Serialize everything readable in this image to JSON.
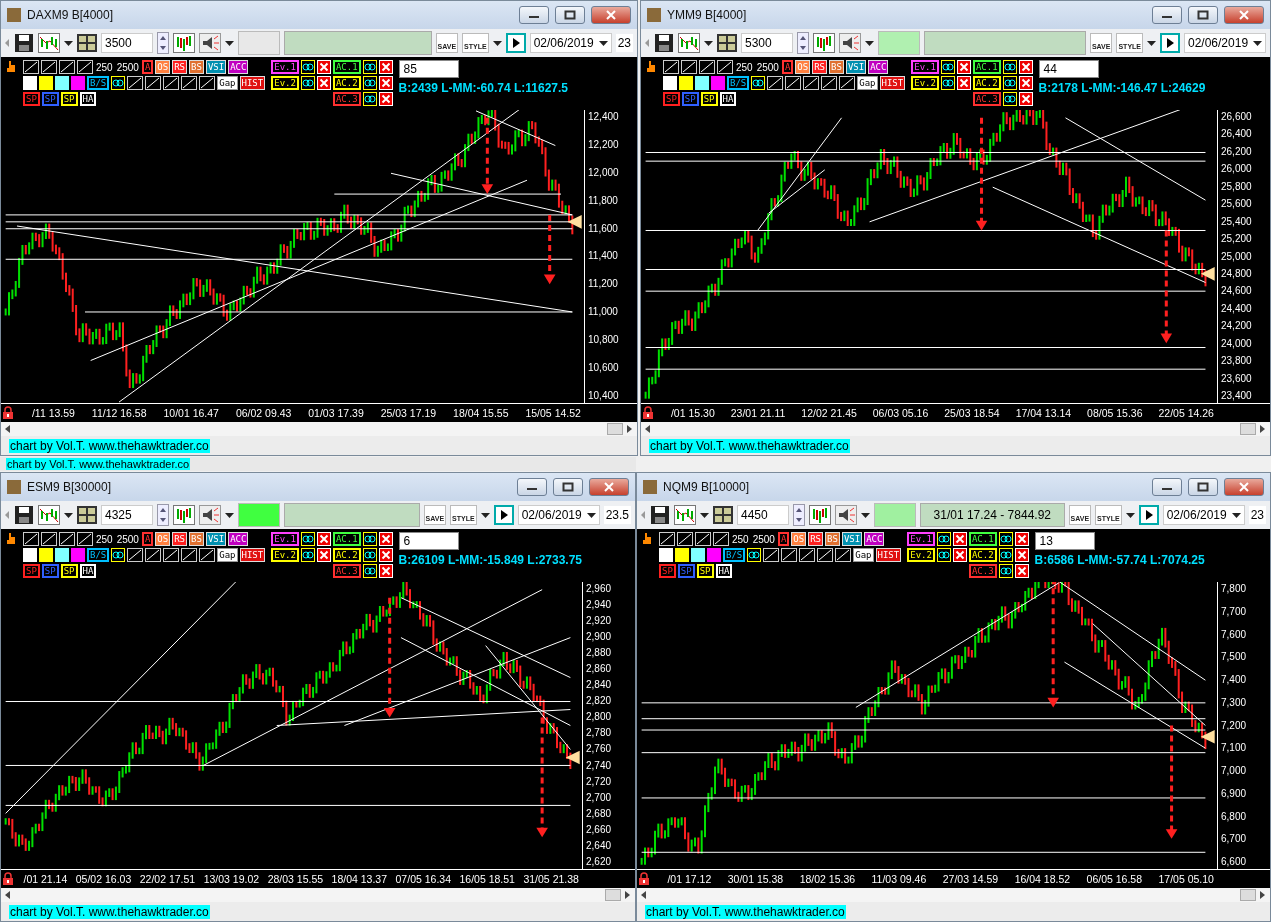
{
  "windows": [
    {
      "title": "DAXM9 B[4000]",
      "bars": "3500",
      "color": "#e8e8e8",
      "buttons": [
        "SAVE",
        "STYLE"
      ],
      "date": "02/06/2019",
      "time_cut": "23",
      "level_box": "85",
      "info": "B:2439 L-MM:-60.74 L:11627.5",
      "tool_rows": [
        [
          {
            "kind": "tool"
          },
          {
            "kind": "tool"
          },
          {
            "kind": "tool"
          },
          {
            "kind": "tool"
          },
          {
            "kind": "num",
            "label": "250"
          },
          {
            "kind": "num",
            "label": "2500"
          },
          {
            "kind": "outline",
            "label": "A",
            "color": "#ff3030"
          },
          {
            "kind": "filled",
            "label": "OS",
            "color": "#ff8040"
          },
          {
            "kind": "filled",
            "label": "RS",
            "color": "#ff2020"
          },
          {
            "kind": "filled",
            "label": "BS",
            "color": "#e07030"
          },
          {
            "kind": "filled",
            "label": "VSI",
            "color": "#0090b0"
          },
          {
            "kind": "filled",
            "label": "ACC",
            "color": "#c000c0"
          }
        ],
        [
          {
            "kind": "swatch",
            "color": "#ffffff"
          },
          {
            "kind": "swatch",
            "color": "#ffff00"
          },
          {
            "kind": "swatch",
            "color": "#80ffff"
          },
          {
            "kind": "swatch",
            "color": "#ff00ff"
          },
          {
            "kind": "outline",
            "label": "B/S",
            "color": "#00c0ff"
          },
          {
            "kind": "link"
          },
          {
            "kind": "tool"
          },
          {
            "kind": "tool"
          },
          {
            "kind": "tool"
          },
          {
            "kind": "tool"
          },
          {
            "kind": "tool"
          },
          {
            "kind": "plain",
            "label": "Gap",
            "color": "#ffffff"
          },
          {
            "kind": "filled",
            "label": "HIST",
            "color": "#e01010"
          }
        ],
        [
          {
            "kind": "outline",
            "label": "SP",
            "color": "#ff2020"
          },
          {
            "kind": "outline",
            "label": "SP",
            "color": "#3060ff"
          },
          {
            "kind": "outline",
            "label": "SP",
            "color": "#ffff00"
          },
          {
            "kind": "outline",
            "label": "HA",
            "color": "#ffffff"
          }
        ]
      ],
      "event_rows": [
        [
          {
            "kind": "outline",
            "label": "Ev.1",
            "color": "#ff40ff"
          },
          {
            "kind": "link"
          },
          {
            "kind": "close"
          },
          {
            "kind": "outline",
            "label": "AC.1",
            "color": "#40ff40"
          },
          {
            "kind": "link"
          },
          {
            "kind": "close"
          }
        ],
        [
          {
            "kind": "outline",
            "label": "Ev.2",
            "color": "#ffff00"
          },
          {
            "kind": "link"
          },
          {
            "kind": "close"
          },
          {
            "kind": "outline",
            "label": "AC.2",
            "color": "#ffff00"
          },
          {
            "kind": "link"
          },
          {
            "kind": "close"
          }
        ],
        [
          {
            "kind": "outline",
            "label": "AC.3",
            "color": "#ff3030"
          },
          {
            "kind": "link"
          },
          {
            "kind": "close"
          }
        ]
      ],
      "price_axis": [
        "12,400",
        "12,200",
        "12,000",
        "11,800",
        "11,600",
        "11,400",
        "11,200",
        "11,000",
        "10,800",
        "10,600",
        "10,400"
      ],
      "time_axis": [
        "/11 13.59",
        "11/12 16.58",
        "10/01 16.47",
        "06/02 09.43",
        "01/03 17.39",
        "25/03 17.19",
        "18/04 15.55",
        "15/05 14.52"
      ],
      "footer": "chart by Vol.T. www.thehawktrader.co"
    },
    {
      "title": "YMM9 B[4000]",
      "bars": "5300",
      "color": "#b0f0b0",
      "buttons": [
        "SAVE",
        "STYLE"
      ],
      "date": "02/06/2019",
      "level_box": "44",
      "info": "B:2178 L-MM:-146.47 L:24629",
      "tool_rows": [
        [
          {
            "kind": "tool"
          },
          {
            "kind": "tool"
          },
          {
            "kind": "tool"
          },
          {
            "kind": "tool"
          },
          {
            "kind": "num",
            "label": "250"
          },
          {
            "kind": "num",
            "label": "2500"
          },
          {
            "kind": "outline",
            "label": "A",
            "color": "#ff3030"
          },
          {
            "kind": "filled",
            "label": "OS",
            "color": "#ff8040"
          },
          {
            "kind": "filled",
            "label": "RS",
            "color": "#ff2020"
          },
          {
            "kind": "filled",
            "label": "BS",
            "color": "#e07030"
          },
          {
            "kind": "filled",
            "label": "VSI",
            "color": "#0090b0"
          },
          {
            "kind": "filled",
            "label": "ACC",
            "color": "#c000c0"
          }
        ],
        [
          {
            "kind": "swatch",
            "color": "#ffffff"
          },
          {
            "kind": "swatch",
            "color": "#ffff00"
          },
          {
            "kind": "swatch",
            "color": "#80ffff"
          },
          {
            "kind": "swatch",
            "color": "#ff00ff"
          },
          {
            "kind": "outline",
            "label": "B/S",
            "color": "#00c0ff"
          },
          {
            "kind": "link"
          },
          {
            "kind": "tool"
          },
          {
            "kind": "tool"
          },
          {
            "kind": "tool"
          },
          {
            "kind": "tool"
          },
          {
            "kind": "tool"
          },
          {
            "kind": "plain",
            "label": "Gap",
            "color": "#ffffff"
          },
          {
            "kind": "filled",
            "label": "HIST",
            "color": "#e01010"
          }
        ],
        [
          {
            "kind": "outline",
            "label": "SP",
            "color": "#ff2020"
          },
          {
            "kind": "outline",
            "label": "SP",
            "color": "#3060ff"
          },
          {
            "kind": "outline",
            "label": "SP",
            "color": "#ffff00"
          },
          {
            "kind": "outline",
            "label": "HA",
            "color": "#ffffff"
          }
        ]
      ],
      "event_rows": [
        [
          {
            "kind": "outline",
            "label": "Ev.1",
            "color": "#ff40ff"
          },
          {
            "kind": "link"
          },
          {
            "kind": "close"
          },
          {
            "kind": "outline",
            "label": "AC.1",
            "color": "#40ff40"
          },
          {
            "kind": "link"
          },
          {
            "kind": "close"
          }
        ],
        [
          {
            "kind": "outline",
            "label": "Ev.2",
            "color": "#ffff00"
          },
          {
            "kind": "link"
          },
          {
            "kind": "close"
          },
          {
            "kind": "outline",
            "label": "AC.2",
            "color": "#ffff00"
          },
          {
            "kind": "link"
          },
          {
            "kind": "close"
          }
        ],
        [
          {
            "kind": "outline",
            "label": "AC.3",
            "color": "#ff3030"
          },
          {
            "kind": "link"
          },
          {
            "kind": "close"
          }
        ]
      ],
      "price_axis": [
        "26,600",
        "26,400",
        "26,200",
        "26,000",
        "25,800",
        "25,600",
        "25,400",
        "25,200",
        "25,000",
        "24,800",
        "24,600",
        "24,400",
        "24,200",
        "24,000",
        "23,800",
        "23,600",
        "23,400"
      ],
      "time_axis": [
        "/01 15.30",
        "23/01 21.11",
        "12/02 21.45",
        "06/03 05.16",
        "25/03 18.54",
        "17/04 13.14",
        "08/05 15.36",
        "22/05 14.26"
      ],
      "footer": "chart by Vol.T. www.thehawktrader.co"
    },
    {
      "title": "ESM9 B[30000]",
      "bars": "4325",
      "color": "#40ff40",
      "buttons": [
        "SAVE",
        "STYLE"
      ],
      "date": "02/06/2019",
      "time_cut": "23.5",
      "level_box": "6",
      "info": "B:26109 L-MM:-15.849 L:2733.75",
      "tool_rows": [
        [
          {
            "kind": "tool"
          },
          {
            "kind": "tool"
          },
          {
            "kind": "tool"
          },
          {
            "kind": "tool"
          },
          {
            "kind": "num",
            "label": "250"
          },
          {
            "kind": "num",
            "label": "2500"
          },
          {
            "kind": "outline",
            "label": "A",
            "color": "#ff3030"
          },
          {
            "kind": "filled",
            "label": "OS",
            "color": "#ff8040"
          },
          {
            "kind": "filled",
            "label": "RS",
            "color": "#ff2020"
          },
          {
            "kind": "filled",
            "label": "BS",
            "color": "#e07030"
          },
          {
            "kind": "filled",
            "label": "VSI",
            "color": "#0090b0"
          },
          {
            "kind": "filled",
            "label": "ACC",
            "color": "#c000c0"
          }
        ],
        [
          {
            "kind": "swatch",
            "color": "#ffffff"
          },
          {
            "kind": "swatch",
            "color": "#ffff00"
          },
          {
            "kind": "swatch",
            "color": "#80ffff"
          },
          {
            "kind": "swatch",
            "color": "#ff00ff"
          },
          {
            "kind": "outline",
            "label": "B/S",
            "color": "#00c0ff"
          },
          {
            "kind": "link"
          },
          {
            "kind": "tool"
          },
          {
            "kind": "tool"
          },
          {
            "kind": "tool"
          },
          {
            "kind": "tool"
          },
          {
            "kind": "tool"
          },
          {
            "kind": "plain",
            "label": "Gap",
            "color": "#ffffff"
          },
          {
            "kind": "filled",
            "label": "HIST",
            "color": "#e01010"
          }
        ],
        [
          {
            "kind": "outline",
            "label": "SP",
            "color": "#ff2020"
          },
          {
            "kind": "outline",
            "label": "SP",
            "color": "#3060ff"
          },
          {
            "kind": "outline",
            "label": "SP",
            "color": "#ffff00"
          },
          {
            "kind": "outline",
            "label": "HA",
            "color": "#ffffff"
          }
        ]
      ],
      "event_rows": [
        [
          {
            "kind": "outline",
            "label": "Ev.1",
            "color": "#ff40ff"
          },
          {
            "kind": "link"
          },
          {
            "kind": "close"
          },
          {
            "kind": "outline",
            "label": "AC.1",
            "color": "#40ff40"
          },
          {
            "kind": "link"
          },
          {
            "kind": "close"
          }
        ],
        [
          {
            "kind": "outline",
            "label": "Ev.2",
            "color": "#ffff00"
          },
          {
            "kind": "link"
          },
          {
            "kind": "close"
          },
          {
            "kind": "outline",
            "label": "AC.2",
            "color": "#ffff00"
          },
          {
            "kind": "link"
          },
          {
            "kind": "close"
          }
        ],
        [
          {
            "kind": "outline",
            "label": "AC.3",
            "color": "#ff3030"
          },
          {
            "kind": "link"
          },
          {
            "kind": "close"
          }
        ]
      ],
      "price_axis": [
        "2,960",
        "2,940",
        "2,920",
        "2,900",
        "2,880",
        "2,860",
        "2,840",
        "2,820",
        "2,800",
        "2,780",
        "2,760",
        "2,740",
        "2,720",
        "2,700",
        "2,680",
        "2,660",
        "2,640",
        "2,620"
      ],
      "time_axis": [
        "/01 21.14",
        "05/02 16.03",
        "22/02 17.51",
        "13/03 19.02",
        "28/03 15.55",
        "18/04 13.37",
        "07/05 16.34",
        "16/05 18.51",
        "31/05 21.38"
      ],
      "footer": "chart by Vol.T. www.thehawktrader.co"
    },
    {
      "title": "NQM9 B[10000]",
      "bars": "4450",
      "color": "#a0f0a0",
      "status_text": "31/01 17.24 - 7844.92",
      "buttons": [
        "SAVE",
        "STYLE"
      ],
      "date": "02/06/2019",
      "time_cut": "23",
      "level_box": "13",
      "info": "B:6586 L-MM:-57.74 L:7074.25",
      "tool_rows": [
        [
          {
            "kind": "tool"
          },
          {
            "kind": "tool"
          },
          {
            "kind": "tool"
          },
          {
            "kind": "tool"
          },
          {
            "kind": "num",
            "label": "250"
          },
          {
            "kind": "num",
            "label": "2500"
          },
          {
            "kind": "outline",
            "label": "A",
            "color": "#ff3030"
          },
          {
            "kind": "filled",
            "label": "OS",
            "color": "#ff8040"
          },
          {
            "kind": "filled",
            "label": "RS",
            "color": "#ff2020"
          },
          {
            "kind": "filled",
            "label": "BS",
            "color": "#e07030"
          },
          {
            "kind": "filled",
            "label": "VSI",
            "color": "#0090b0"
          },
          {
            "kind": "filled",
            "label": "ACC",
            "color": "#c000c0"
          }
        ],
        [
          {
            "kind": "swatch",
            "color": "#ffffff"
          },
          {
            "kind": "swatch",
            "color": "#ffff00"
          },
          {
            "kind": "swatch",
            "color": "#80ffff"
          },
          {
            "kind": "swatch",
            "color": "#ff00ff"
          },
          {
            "kind": "outline",
            "label": "B/S",
            "color": "#00c0ff"
          },
          {
            "kind": "link"
          },
          {
            "kind": "tool"
          },
          {
            "kind": "tool"
          },
          {
            "kind": "tool"
          },
          {
            "kind": "tool"
          },
          {
            "kind": "tool"
          },
          {
            "kind": "plain",
            "label": "Gap",
            "color": "#ffffff"
          },
          {
            "kind": "filled",
            "label": "HIST",
            "color": "#e01010"
          }
        ],
        [
          {
            "kind": "outline",
            "label": "SP",
            "color": "#ff2020"
          },
          {
            "kind": "outline",
            "label": "SP",
            "color": "#3060ff"
          },
          {
            "kind": "outline",
            "label": "SP",
            "color": "#ffff00"
          },
          {
            "kind": "outline",
            "label": "HA",
            "color": "#ffffff"
          }
        ]
      ],
      "event_rows": [
        [
          {
            "kind": "outline",
            "label": "Ev.1",
            "color": "#ff40ff"
          },
          {
            "kind": "link"
          },
          {
            "kind": "close"
          },
          {
            "kind": "outline",
            "label": "AC.1",
            "color": "#40ff40"
          },
          {
            "kind": "link"
          },
          {
            "kind": "close"
          }
        ],
        [
          {
            "kind": "outline",
            "label": "Ev.2",
            "color": "#ffff00"
          },
          {
            "kind": "link"
          },
          {
            "kind": "close"
          },
          {
            "kind": "outline",
            "label": "AC.2",
            "color": "#ffff00"
          },
          {
            "kind": "link"
          },
          {
            "kind": "close"
          }
        ],
        [
          {
            "kind": "outline",
            "label": "AC.3",
            "color": "#ff3030"
          },
          {
            "kind": "link"
          },
          {
            "kind": "close"
          }
        ]
      ],
      "price_axis": [
        "7,800",
        "7,700",
        "7,600",
        "7,500",
        "7,400",
        "7,300",
        "7,200",
        "7,100",
        "7,000",
        "6,900",
        "6,800",
        "6,700",
        "6,600"
      ],
      "time_axis": [
        "/01 17.12",
        "30/01 15.38",
        "18/02 15.36",
        "11/03 09.46",
        "27/03 14.59",
        "16/04 18.52",
        "06/05 16.58",
        "17/05 05.10"
      ],
      "footer": "chart by Vol.T. www.thehawktrader.co"
    }
  ],
  "background_footer": "chart by Vol.T. www.thehawktrader.co"
}
